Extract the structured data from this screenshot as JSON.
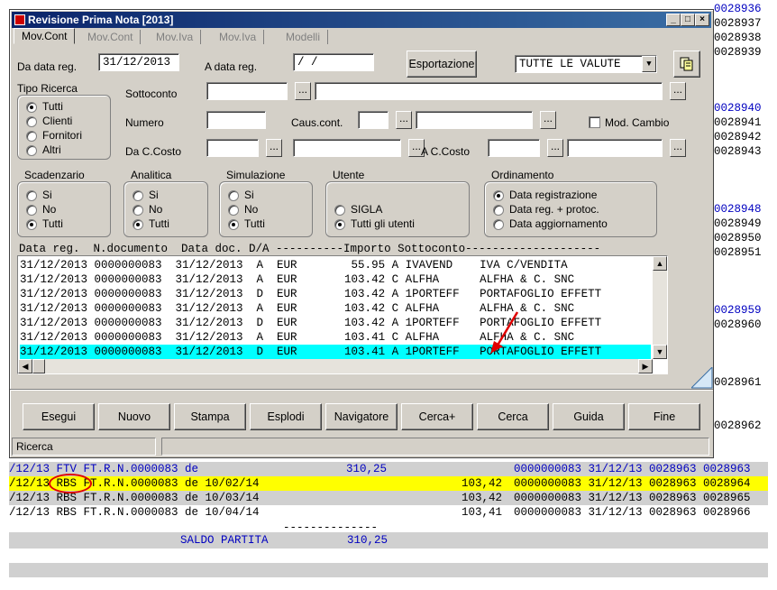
{
  "window": {
    "title": "Revisione Prima Nota [2013]",
    "tabs": [
      "Mov.Cont",
      "Mov.Cont",
      "Mov.Iva",
      "Mov.Iva",
      "Modelli"
    ]
  },
  "filters": {
    "da_data_label": "Da data reg.",
    "da_data_value": "31/12/2013",
    "a_data_label": "A data reg.",
    "a_data_value": "  /  /",
    "esportazione": "Esportazione",
    "valute": "TUTTE LE VALUTE",
    "sottoconto_label": "Sottoconto",
    "numero_label": "Numero",
    "caus_label": "Caus.cont.",
    "mod_cambio_label": "Mod. Cambio",
    "da_ccosto_label": "Da C.Costo",
    "a_ccosto_label": "A C.Costo"
  },
  "tipo_ricerca": {
    "title": "Tipo Ricerca",
    "options": [
      "Tutti",
      "Clienti",
      "Fornitori",
      "Altri"
    ],
    "selected": 0
  },
  "scadenzario": {
    "title": "Scadenzario",
    "options": [
      "Si",
      "No",
      "Tutti"
    ],
    "selected": 2
  },
  "analitica": {
    "title": "Analitica",
    "options": [
      "Si",
      "No",
      "Tutti"
    ],
    "selected": 2
  },
  "simulazione": {
    "title": "Simulazione",
    "options": [
      "Si",
      "No",
      "Tutti"
    ],
    "selected": 2
  },
  "utente": {
    "title": "Utente",
    "options": [
      "SIGLA",
      "Tutti gli utenti"
    ],
    "selected": 1
  },
  "ordinamento": {
    "title": "Ordinamento",
    "options": [
      "Data registrazione",
      "Data reg. + protoc.",
      "Data aggiornamento"
    ],
    "selected": 0
  },
  "grid": {
    "header": "Data reg.  N.documento  Data doc. D/A ----------Importo Sottoconto--------------------",
    "rows": [
      "31/12/2013 0000000083  31/12/2013  A  EUR        55.95 A IVAVEND    IVA C/VENDITA",
      "31/12/2013 0000000083  31/12/2013  A  EUR       103.42 C ALFHA      ALFHA & C. SNC",
      "31/12/2013 0000000083  31/12/2013  D  EUR       103.42 A 1PORTEFF   PORTAFOGLIO EFFETT",
      "31/12/2013 0000000083  31/12/2013  A  EUR       103.42 C ALFHA      ALFHA & C. SNC",
      "31/12/2013 0000000083  31/12/2013  D  EUR       103.42 A 1PORTEFF   PORTAFOGLIO EFFETT",
      "31/12/2013 0000000083  31/12/2013  A  EUR       103.41 C ALFHA      ALFHA & C. SNC",
      "31/12/2013 0000000083  31/12/2013  D  EUR       103.41 A 1PORTEFF   PORTAFOGLIO EFFETT"
    ],
    "selected_row": 6
  },
  "buttons": [
    "Esegui",
    "Nuovo",
    "Stampa",
    "Esplodi",
    "Navigatore",
    "Cerca+",
    "Cerca",
    "Guida",
    "Fine"
  ],
  "status": {
    "text": "Ricerca",
    "extra": ""
  },
  "background": {
    "right_col_top": [
      "0028936",
      "0028937",
      "0028938",
      "0028939"
    ],
    "right_col_mid": [
      "0028940",
      "0028941",
      "0028942",
      "0028943"
    ],
    "right_col_mid2": [
      "0028948",
      "0028949",
      "0028950",
      "0028951"
    ],
    "right_col_mid3": [
      "0028959",
      "0028960"
    ],
    "right_col_single1": "0028961",
    "right_col_single2": "0028962",
    "rows": [
      [
        "/12/13 FTV FT.R.N.0000083 de",
        "310,25",
        "",
        "0000000083 31/12/13 0028963 0028963"
      ],
      [
        "/12/13 RBS FT.R.N.0000083 de 10/02/14",
        "",
        "103,42",
        "0000000083 31/12/13 0028963 0028964"
      ],
      [
        "/12/13 RBS FT.R.N.0000083 de 10/03/14",
        "",
        "103,42",
        "0000000083 31/12/13 0028963 0028965"
      ],
      [
        "/12/13 RBS FT.R.N.0000083 de 10/04/14",
        "",
        "103,41",
        "0000000083 31/12/13 0028963 0028966"
      ]
    ],
    "separator": "--------------",
    "saldo_label": "SALDO PARTITA",
    "saldo_value": "310,25"
  },
  "colors": {
    "blue_text": "#0000c0",
    "highlight": "#ffff00",
    "selection": "#00ffff",
    "annotation": "#e00000"
  }
}
